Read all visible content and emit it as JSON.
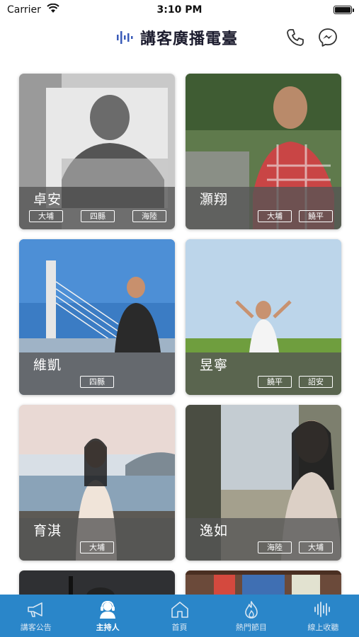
{
  "status_bar": {
    "carrier": "Carrier",
    "time": "3:10 PM"
  },
  "header": {
    "app_title": "講客廣播電臺"
  },
  "hosts": [
    {
      "name": "卓安",
      "tags": [
        "大埔",
        "四縣",
        "海陸"
      ]
    },
    {
      "name": "灝翔",
      "tags": [
        "大埔",
        "饒平"
      ]
    },
    {
      "name": "維凱",
      "tags": [
        "四縣"
      ]
    },
    {
      "name": "昱寧",
      "tags": [
        "饒平",
        "詔安"
      ]
    },
    {
      "name": "育淇",
      "tags": [
        "大埔"
      ]
    },
    {
      "name": "逸如",
      "tags": [
        "海陸",
        "大埔"
      ]
    }
  ],
  "tab_bar": {
    "tabs": [
      {
        "label": "講客公告",
        "icon": "megaphone-icon"
      },
      {
        "label": "主持人",
        "icon": "headset-person-icon",
        "active": true
      },
      {
        "label": "首頁",
        "icon": "home-icon"
      },
      {
        "label": "熱門節目",
        "icon": "flame-icon"
      },
      {
        "label": "線上收聽",
        "icon": "soundwave-icon"
      }
    ]
  },
  "colors": {
    "tab_bar": "#2a86c9",
    "overlay": "#555555",
    "logo_accent": "#3a5bb8"
  }
}
